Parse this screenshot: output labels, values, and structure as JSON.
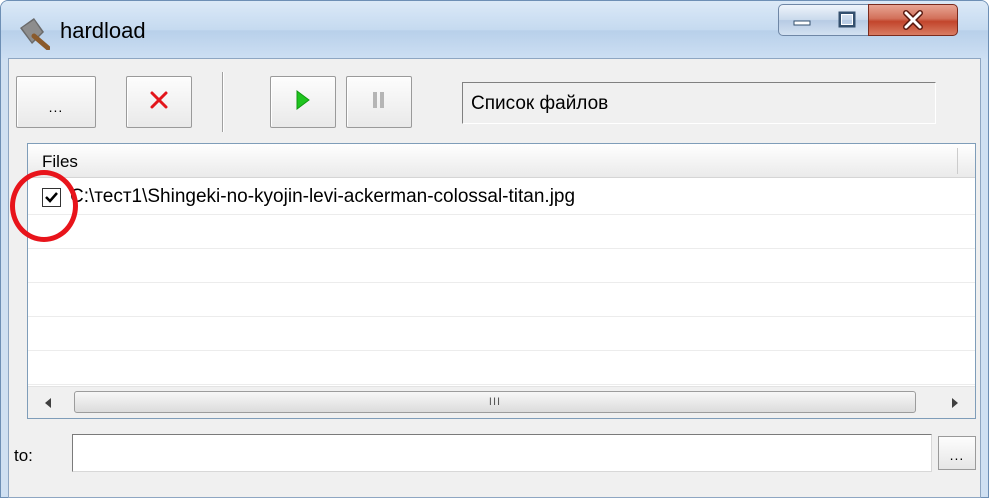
{
  "window": {
    "title": "hardload",
    "controls": {
      "minimize": "minimize",
      "maximize": "maximize",
      "close": "close"
    }
  },
  "toolbar": {
    "browse_label": "...",
    "status_text": "Список файлов"
  },
  "files_list": {
    "column_header": "Files",
    "rows": [
      {
        "checked": true,
        "path": "C:\\тест1\\Shingeki-no-kyojin-levi-ackerman-colossal-titan.jpg"
      }
    ],
    "scrollbar_thumb_glyph": "III"
  },
  "destination": {
    "label": "to:",
    "value": "",
    "browse_label": "..."
  },
  "colors": {
    "remove_icon": "#e3151b",
    "play_icon": "#1fc41f",
    "annotation": "#e8141b"
  }
}
